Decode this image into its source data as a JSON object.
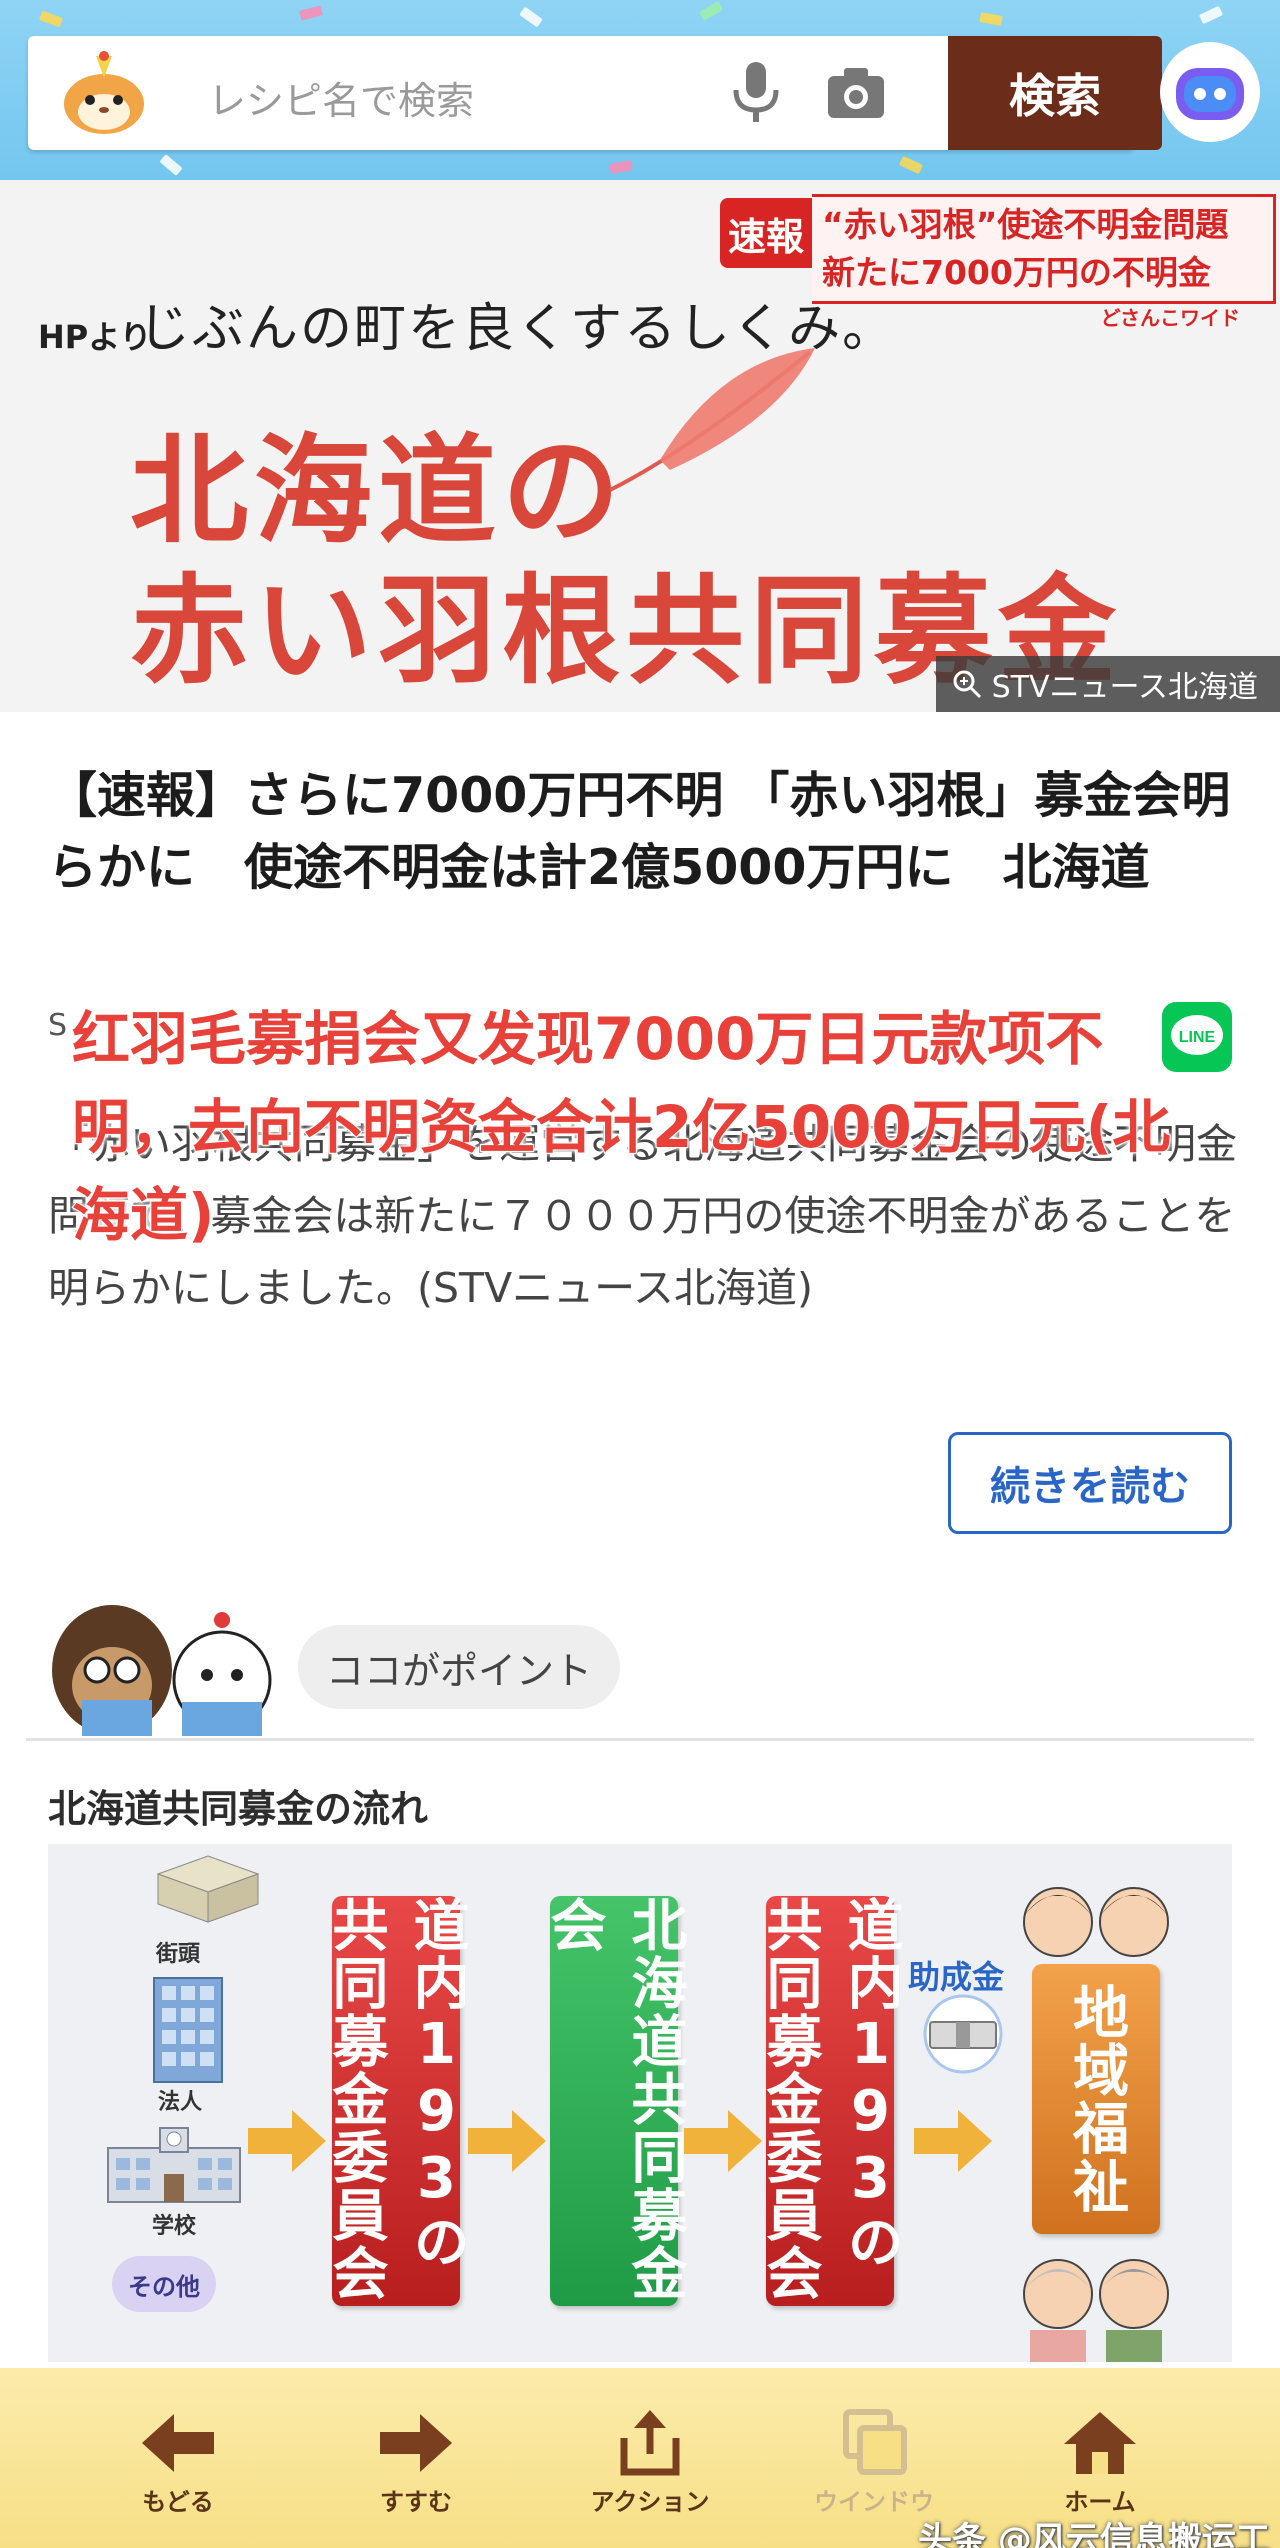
{
  "header": {
    "search_placeholder": "レシピ名で検索",
    "search_button": "検索"
  },
  "hero": {
    "hp_label": "HPより",
    "tagline": "じぶんの町を良くするしくみ。",
    "title_line1": "北海道の",
    "title_line2": "赤い羽根共同募金",
    "flash_badge": "速報",
    "flash_line1": "“赤い羽根”使途不明金問題",
    "flash_line2": "新たに7000万円の不明金",
    "flash_source": "どさんこワイド",
    "credit": "STVニュース北海道"
  },
  "article": {
    "title": "【速報】さらに7000万円不明 「赤い羽根」募金会明らかに　使途不明金は計2億5000万円に　北海道",
    "byline": "S",
    "body": "「赤い羽根共同募金」を運営する北海道共同募金会の使途不明金問題で、募金会は新たに７０００万円の使途不明金があることを明らかにしました。(STVニュース北海道)",
    "overlay_caption": "红羽毛募捐会又发现7000万日元款项不明，去向不明资金合计2亿5000万日元(北海道)",
    "read_more": "続きを読む"
  },
  "point": {
    "bubble": "ココがポイント",
    "flow_heading": "北海道共同募金の流れ"
  },
  "flow": {
    "sources": [
      "街頭",
      "法人",
      "学校",
      "その他"
    ],
    "box1": "道内193の共同募金委員会",
    "box2": "北海道共同募金会",
    "box3": "道内193の共同募金委員会",
    "grant": "助成金",
    "box4": "地域福祉"
  },
  "bottom_nav": [
    {
      "label": "もどる"
    },
    {
      "label": "すすむ"
    },
    {
      "label": "アクション"
    },
    {
      "label": "ウインドウ"
    },
    {
      "label": "ホーム"
    }
  ],
  "watermark": "头条 @风云信息搬运工",
  "colors": {
    "header_bg": "#74c6ef",
    "search_button": "#6b2c1a",
    "hero_red": "#d9473b",
    "link_blue": "#2a66c8",
    "bottom_bar": "#f7df86"
  }
}
